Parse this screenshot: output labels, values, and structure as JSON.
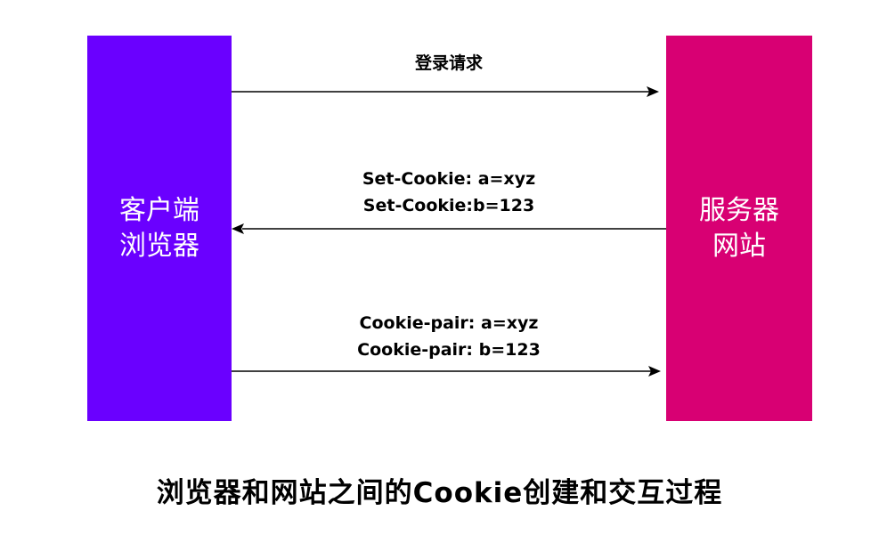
{
  "client": {
    "line1": "客户端",
    "line2": "浏览器",
    "color": "#6A00FF"
  },
  "server": {
    "line1": "服务器",
    "line2": "网站",
    "color": "#D80073"
  },
  "messages": {
    "login": "登录请求",
    "set_cookie_1": "Set-Cookie: a=xyz",
    "set_cookie_2": "Set-Cookie:b=123",
    "cookie_pair_1": "Cookie-pair: a=xyz",
    "cookie_pair_2": "Cookie-pair: b=123"
  },
  "caption": "浏览器和网站之间的Cookie创建和交互过程"
}
